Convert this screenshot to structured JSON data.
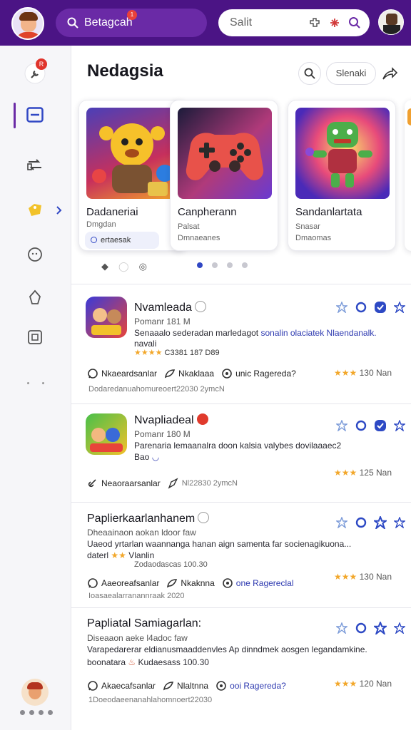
{
  "topbar": {
    "search_label": "Betagcah",
    "notif_badge": "1",
    "search_placeholder": "Salit"
  },
  "sidebar": {
    "badge": "R",
    "items": [
      "notifications",
      "library",
      "transfer",
      "deals",
      "chat",
      "achievements",
      "collections"
    ]
  },
  "header": {
    "title": "Nedagsia",
    "pill_label": "Slenaki"
  },
  "featured": [
    {
      "title": "Dadaneriai",
      "line1": "Dmgdan",
      "chip": "ertaesak"
    },
    {
      "title": "Canpherann",
      "line1": "Palsat",
      "line2": "Dmnaeanes"
    },
    {
      "title": "Sandanlartata",
      "line1": "Snasar",
      "line2": "Dmaomas"
    }
  ],
  "pager_left": {
    "a": "◆",
    "b": "◯",
    "c": "◎"
  },
  "list": [
    {
      "title": "Nvamleada",
      "sub": "Pomanr 181 M",
      "desc_a": "Senaaalo sederadan marledagot",
      "desc_b": "sonalin olaciatek Nlaendanalk.",
      "desc2": "navali",
      "rating_line": "C3381 187 D89",
      "meta1": "Nkaeardsanlar",
      "meta2": "Nkaklaaa",
      "meta3": "unic Ragereda?",
      "rating_r": "130 Nan",
      "footer": "Dodaredanuahomureoert22030  2ymcN"
    },
    {
      "title": "Nvapliadeal",
      "sub": "Pomanr 180 M",
      "desc_a": "Parenaria lemaanalra doon kalsia valybes dovilaaaec2",
      "desc2": "Bao",
      "meta1": "Neaoraarsanlar",
      "meta2": "Nl22830  2ymcN",
      "rating_r": "125 Nan"
    },
    {
      "title": "Paplierkaarlanhanem",
      "sub": "Dheaainaon aokan  ldoor faw",
      "desc_a": "Uaeod yrtarlan waannanga hanan aign samenta far socienagikuona...",
      "desc2": "daterl",
      "desc2b": "Vlanlin",
      "desc3": "Zodaodascas 100.30",
      "meta1": "Aaeoreafsanlar",
      "meta2": "Nkaknna",
      "meta3": "one Ragereclal",
      "rating_r": "130 Nan",
      "footer": "Ioasaealarranannraak 2020"
    },
    {
      "title": "Papliatal Samiagarlan:",
      "sub": "Diseaaon aeke  l4adoc faw",
      "desc_a": "Varapedarerar eldianusmaaddenvles Ap dinndmek aosgen legandamkine.",
      "desc2": "boonatara",
      "desc2b": "Kudaesass 100.30",
      "meta1": "Akaecafsanlar",
      "meta2": "Nlaltnna",
      "meta3": "ooi Ragereda?",
      "rating_r": "120 Nan",
      "footer": "1Doeodaeenanahlahomnoert22030"
    }
  ],
  "colors": {
    "topbar": "#4b1485",
    "accent_purple": "#6a2aa6",
    "link_blue": "#2e3ab0",
    "star": "#f2a72a",
    "badge_red": "#e0342c"
  }
}
